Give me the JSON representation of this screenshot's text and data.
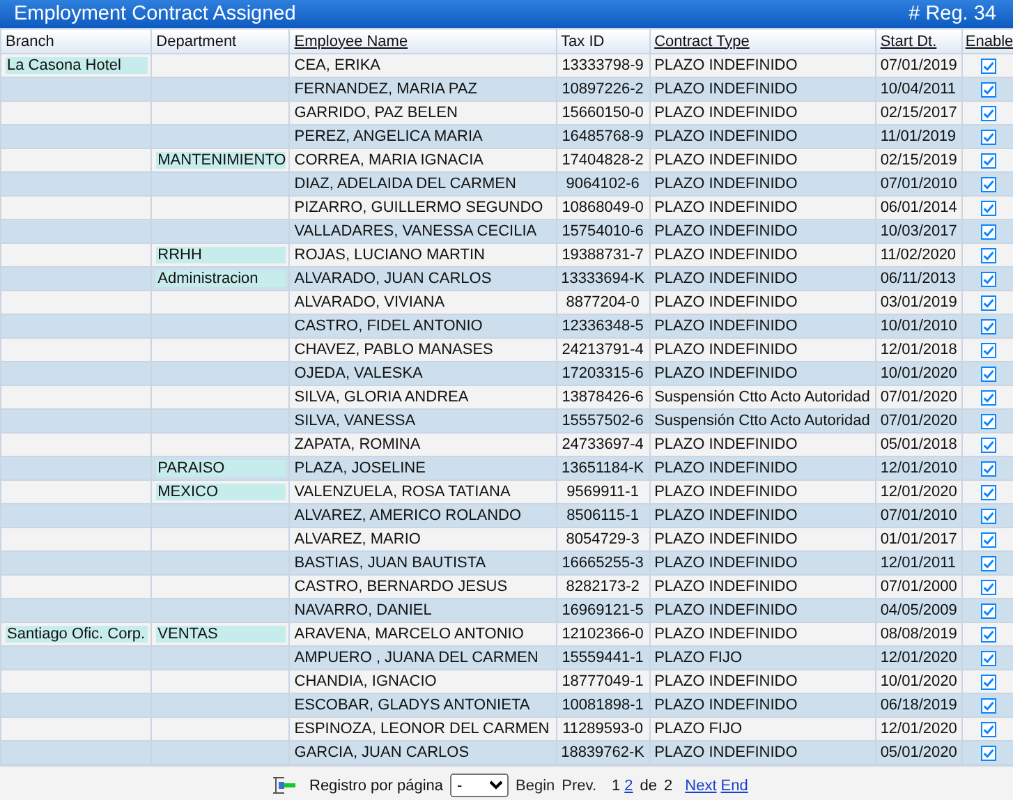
{
  "panel": {
    "title": "Employment Contract Assigned",
    "count": "# Reg. 34"
  },
  "columns": [
    {
      "label": "Branch",
      "sortable": false
    },
    {
      "label": "Department",
      "sortable": false
    },
    {
      "label": "Employee Name",
      "sortable": true
    },
    {
      "label": "Tax ID",
      "sortable": false
    },
    {
      "label": "Contract Type",
      "sortable": true
    },
    {
      "label": "Start Dt.",
      "sortable": true
    },
    {
      "label": "Enable",
      "sortable": true
    }
  ],
  "rows": [
    {
      "branch": "La Casona Hotel",
      "name": "CEA, ERIKA",
      "tax_id": "13333798-9",
      "contract": "PLAZO INDEFINIDO",
      "start": "07/01/2019",
      "enabled": true
    },
    {
      "name": "FERNANDEZ, MARIA PAZ",
      "tax_id": "10897226-2",
      "contract": "PLAZO INDEFINIDO",
      "start": "10/04/2011",
      "enabled": true
    },
    {
      "name": "GARRIDO, PAZ BELEN",
      "tax_id": "15660150-0",
      "contract": "PLAZO INDEFINIDO",
      "start": "02/15/2017",
      "enabled": true
    },
    {
      "name": "PEREZ, ANGELICA MARIA",
      "tax_id": "16485768-9",
      "contract": "PLAZO INDEFINIDO",
      "start": "11/01/2019",
      "enabled": true
    },
    {
      "department": "MANTENIMIENTO",
      "name": "CORREA, MARIA IGNACIA",
      "tax_id": "17404828-2",
      "contract": "PLAZO INDEFINIDO",
      "start": "02/15/2019",
      "enabled": true
    },
    {
      "name": "DIAZ, ADELAIDA DEL CARMEN",
      "tax_id": "9064102-6",
      "contract": "PLAZO INDEFINIDO",
      "start": "07/01/2010",
      "enabled": true
    },
    {
      "name": "PIZARRO, GUILLERMO SEGUNDO",
      "tax_id": "10868049-0",
      "contract": "PLAZO INDEFINIDO",
      "start": "06/01/2014",
      "enabled": true
    },
    {
      "name": "VALLADARES, VANESSA CECILIA",
      "tax_id": "15754010-6",
      "contract": "PLAZO INDEFINIDO",
      "start": "10/03/2017",
      "enabled": true
    },
    {
      "department": "RRHH",
      "name": "ROJAS, LUCIANO MARTIN",
      "tax_id": "19388731-7",
      "contract": "PLAZO INDEFINIDO",
      "start": "11/02/2020",
      "enabled": true
    },
    {
      "department": "Administracion",
      "name": "ALVARADO, JUAN CARLOS",
      "tax_id": "13333694-K",
      "contract": "PLAZO INDEFINIDO",
      "start": "06/11/2013",
      "enabled": true
    },
    {
      "name": "ALVARADO, VIVIANA",
      "tax_id": "8877204-0",
      "contract": "PLAZO INDEFINIDO",
      "start": "03/01/2019",
      "enabled": true
    },
    {
      "name": "CASTRO, FIDEL ANTONIO",
      "tax_id": "12336348-5",
      "contract": "PLAZO INDEFINIDO",
      "start": "10/01/2010",
      "enabled": true
    },
    {
      "name": "CHAVEZ, PABLO MANASES",
      "tax_id": "24213791-4",
      "contract": "PLAZO INDEFINIDO",
      "start": "12/01/2018",
      "enabled": true
    },
    {
      "name": "OJEDA, VALESKA",
      "tax_id": "17203315-6",
      "contract": "PLAZO INDEFINIDO",
      "start": "10/01/2020",
      "enabled": true
    },
    {
      "name": "SILVA, GLORIA ANDREA",
      "tax_id": "13878426-6",
      "contract": "Suspensión Ctto Acto Autoridad",
      "start": "07/01/2020",
      "enabled": true
    },
    {
      "name": "SILVA, VANESSA",
      "tax_id": "15557502-6",
      "contract": "Suspensión Ctto Acto Autoridad",
      "start": "07/01/2020",
      "enabled": true
    },
    {
      "name": "ZAPATA, ROMINA",
      "tax_id": "24733697-4",
      "contract": "PLAZO INDEFINIDO",
      "start": "05/01/2018",
      "enabled": true
    },
    {
      "department": "PARAISO",
      "name": "PLAZA, JOSELINE",
      "tax_id": "13651184-K",
      "contract": "PLAZO INDEFINIDO",
      "start": "12/01/2010",
      "enabled": true
    },
    {
      "department": "MEXICO",
      "name": "VALENZUELA, ROSA TATIANA",
      "tax_id": "9569911-1",
      "contract": "PLAZO INDEFINIDO",
      "start": "12/01/2020",
      "enabled": true
    },
    {
      "name": "ALVAREZ, AMERICO ROLANDO",
      "tax_id": "8506115-1",
      "contract": "PLAZO INDEFINIDO",
      "start": "07/01/2010",
      "enabled": true
    },
    {
      "name": "ALVAREZ, MARIO",
      "tax_id": "8054729-3",
      "contract": "PLAZO INDEFINIDO",
      "start": "01/01/2017",
      "enabled": true
    },
    {
      "name": "BASTIAS, JUAN BAUTISTA",
      "tax_id": "16665255-3",
      "contract": "PLAZO INDEFINIDO",
      "start": "12/01/2011",
      "enabled": true
    },
    {
      "name": "CASTRO, BERNARDO JESUS",
      "tax_id": "8282173-2",
      "contract": "PLAZO INDEFINIDO",
      "start": "07/01/2000",
      "enabled": true
    },
    {
      "name": "NAVARRO, DANIEL",
      "tax_id": "16969121-5",
      "contract": "PLAZO INDEFINIDO",
      "start": "04/05/2009",
      "enabled": true
    },
    {
      "branch": "Santiago Ofic. Corp.",
      "department": "VENTAS",
      "name": "ARAVENA, MARCELO ANTONIO",
      "tax_id": "12102366-0",
      "contract": "PLAZO INDEFINIDO",
      "start": "08/08/2019",
      "enabled": true
    },
    {
      "name": "AMPUERO , JUANA DEL CARMEN",
      "tax_id": "15559441-1",
      "contract": "PLAZO FIJO",
      "start": "12/01/2020",
      "enabled": true
    },
    {
      "name": "CHANDIA, IGNACIO",
      "tax_id": "18777049-1",
      "contract": "PLAZO INDEFINIDO",
      "start": "10/01/2020",
      "enabled": true
    },
    {
      "name": "ESCOBAR, GLADYS ANTONIETA",
      "tax_id": "10081898-1",
      "contract": "PLAZO INDEFINIDO",
      "start": "06/18/2019",
      "enabled": true
    },
    {
      "name": "ESPINOZA, LEONOR DEL CARMEN",
      "tax_id": "11289593-0",
      "contract": "PLAZO FIJO",
      "start": "12/01/2020",
      "enabled": true
    },
    {
      "name": "GARCIA, JUAN CARLOS",
      "tax_id": "18839762-K",
      "contract": "PLAZO INDEFINIDO",
      "start": "05/01/2020",
      "enabled": true
    }
  ],
  "pager": {
    "per_page_label": "Registro por página",
    "per_page_value": "-",
    "nav_before": [
      {
        "label": "Begin",
        "disabled": true
      },
      {
        "label": "Prev.",
        "disabled": true
      }
    ],
    "pages": [
      {
        "label": "1",
        "selected": true
      },
      {
        "label": "2",
        "selected": false
      }
    ],
    "of_label": "de",
    "total_pages": "2",
    "nav_after": [
      {
        "label": "Next",
        "disabled": false
      },
      {
        "label": "End",
        "disabled": false
      }
    ]
  }
}
